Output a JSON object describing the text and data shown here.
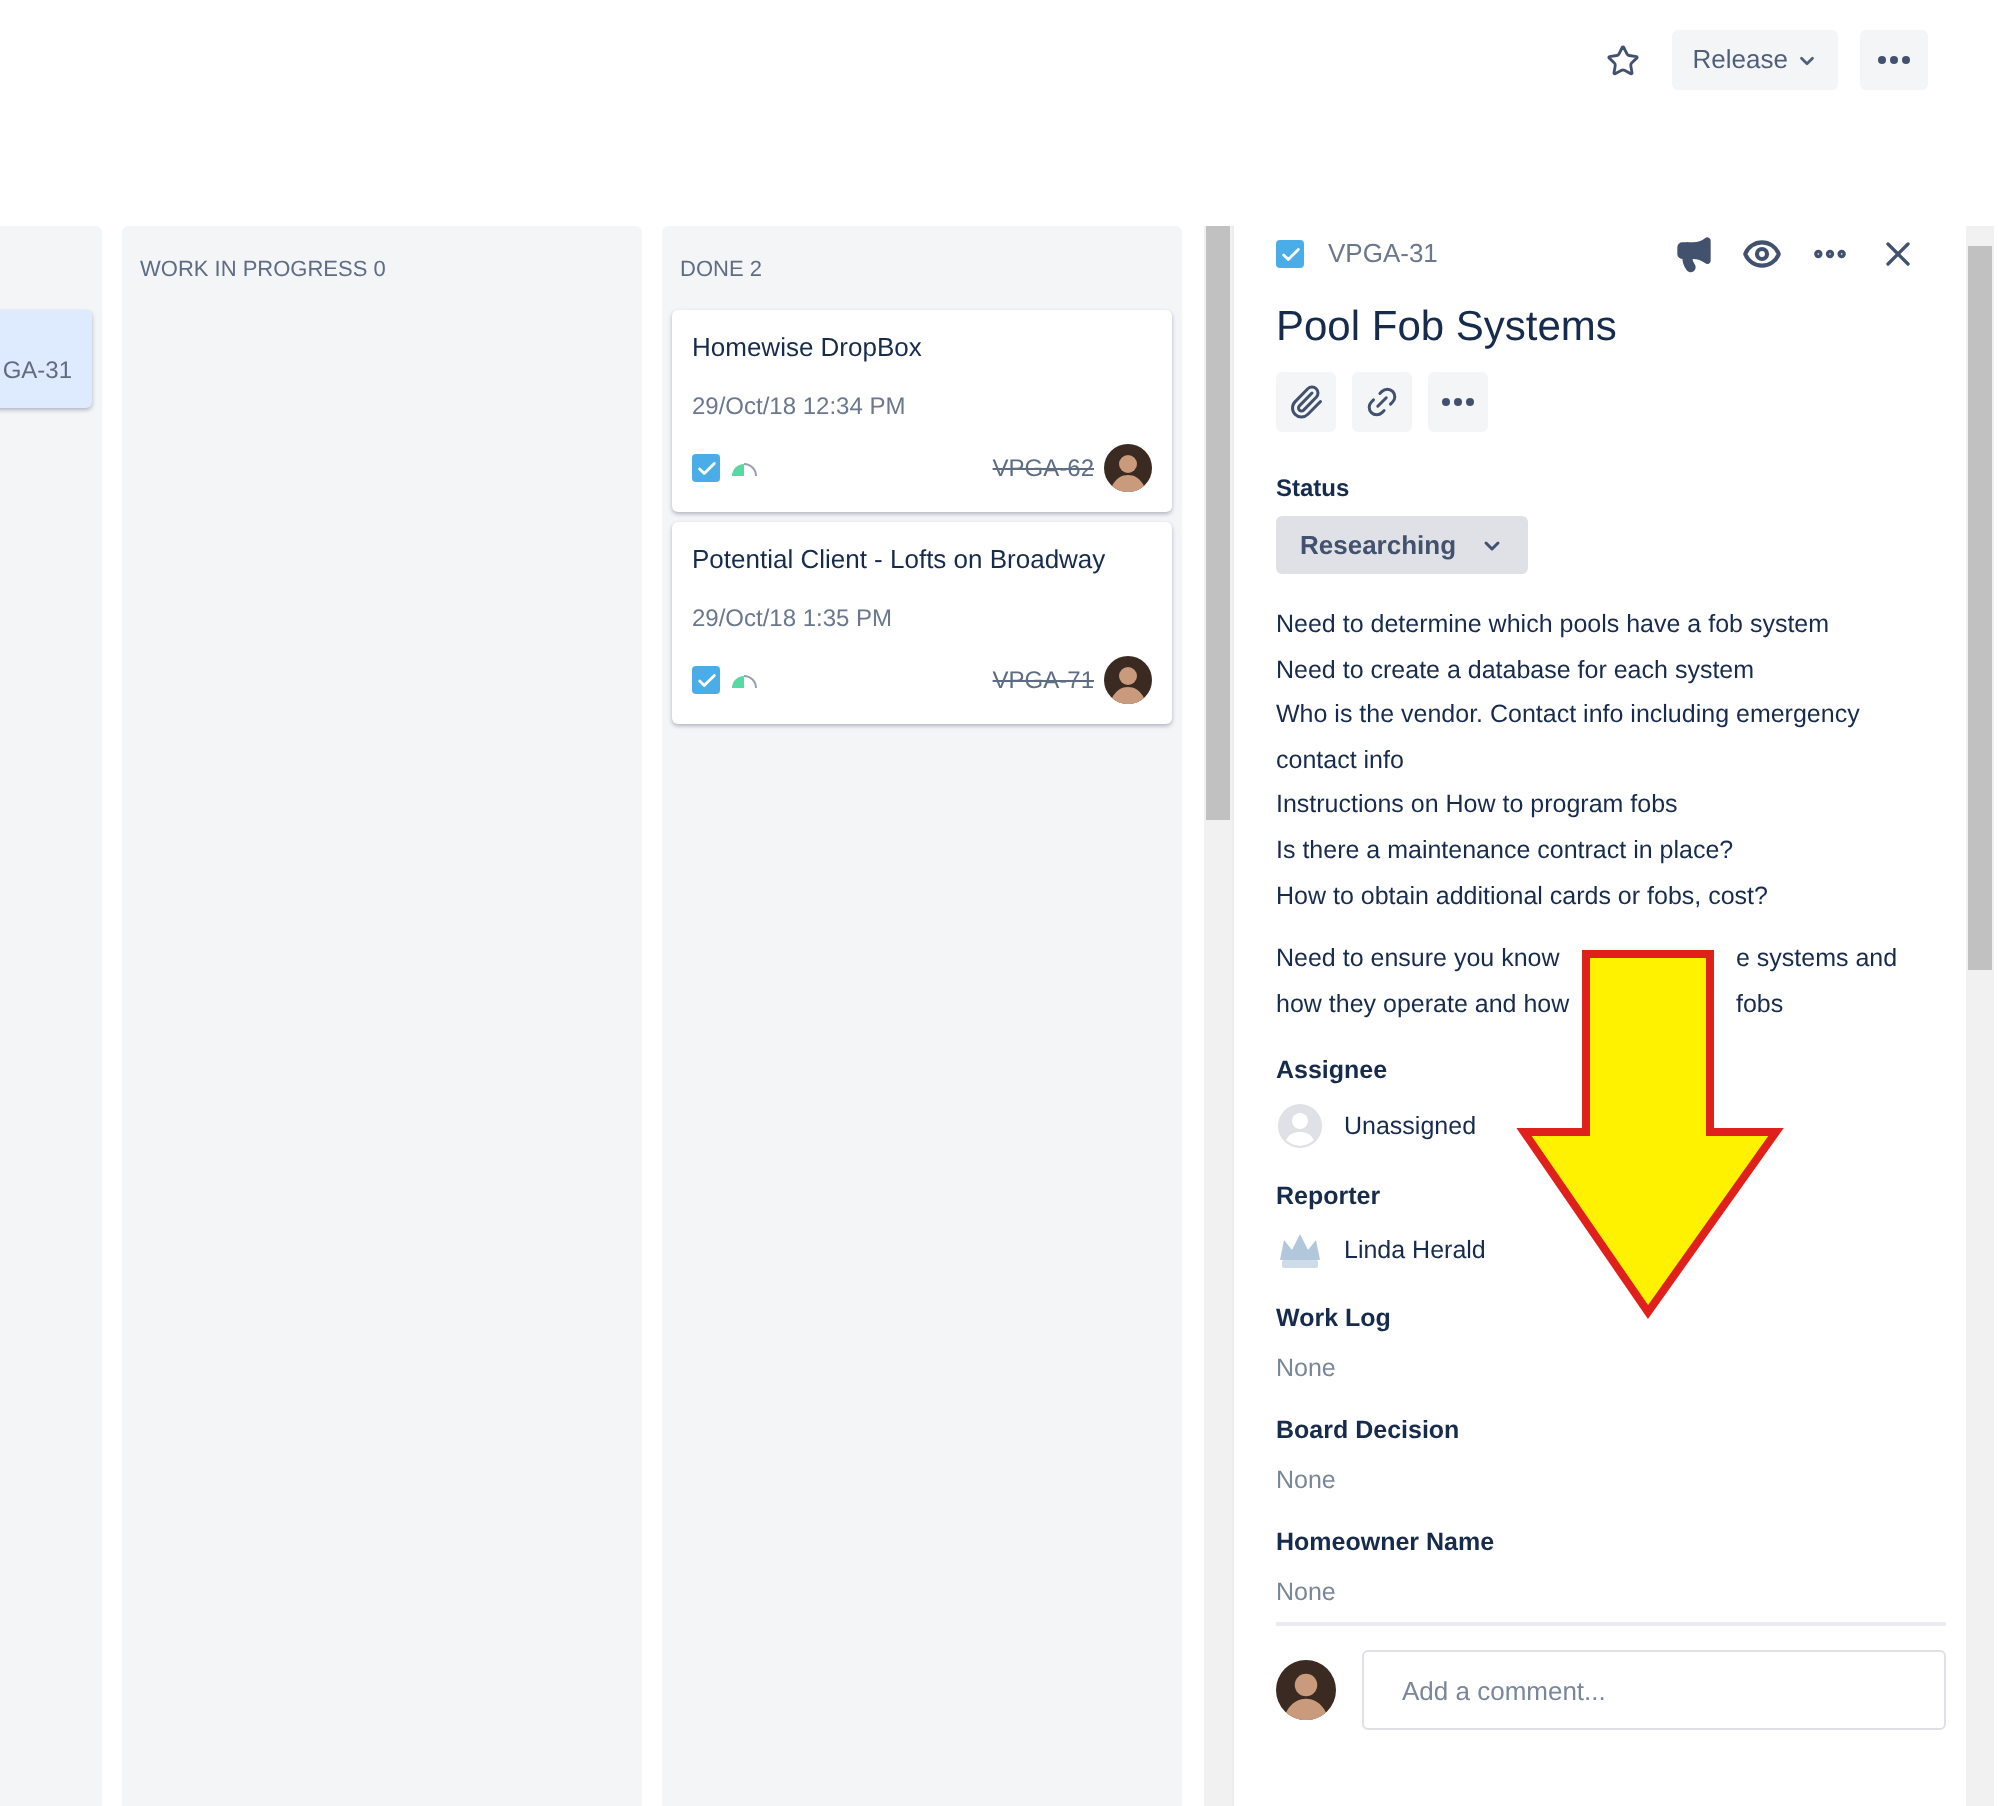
{
  "header": {
    "starred": false,
    "release_button": "Release"
  },
  "columns": [
    {
      "cards": [
        {
          "key": "GA-31",
          "selected": true,
          "resolved": false
        }
      ]
    },
    {
      "title": "WORK IN PROGRESS",
      "count": "0"
    },
    {
      "title": "DONE",
      "count": "2",
      "cards": [
        {
          "title": "Homewise DropBox",
          "date": "29/Oct/18 12:34 PM",
          "key": "VPGA-62",
          "selected": false,
          "resolved": true
        },
        {
          "title": "Potential Client - Lofts on Broadway",
          "date": "29/Oct/18 1:35 PM",
          "key": "VPGA-71",
          "selected": false,
          "resolved": true
        }
      ]
    }
  ],
  "detail": {
    "key": "VPGA-31",
    "title": "Pool Fob Systems",
    "status_label": "Status",
    "status": "Researching",
    "description": [
      "Need to determine which pools have a fob system",
      "Need to create a database for each system",
      "Who is the vendor. Contact info including emergency contact info",
      "Instructions on How to program fobs",
      "Is there a maintenance contract in place?",
      "How to obtain additional cards or fobs, cost?"
    ],
    "description_2": [
      {
        "before": "Need to ensure you know",
        "after": "e systems and"
      },
      {
        "before": "how they operate and how",
        "after": "fobs"
      }
    ],
    "fields": [
      {
        "label": "Assignee",
        "kind": "unassigned",
        "value": "Unassigned"
      },
      {
        "label": "Reporter",
        "kind": "user",
        "value": "Linda Herald"
      },
      {
        "label": "Work Log",
        "kind": "empty",
        "value": "None"
      },
      {
        "label": "Board Decision",
        "kind": "empty",
        "value": "None"
      },
      {
        "label": "Homeowner Name",
        "kind": "empty",
        "value": "None"
      }
    ],
    "comment_placeholder": "Add a comment..."
  }
}
